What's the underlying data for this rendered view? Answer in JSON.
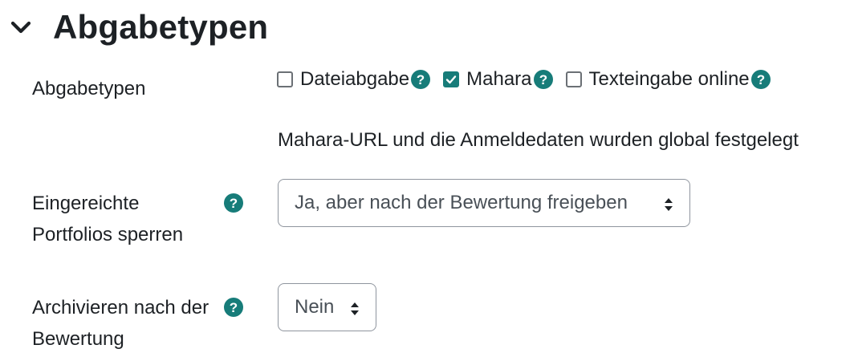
{
  "section": {
    "title": "Abgabetypen",
    "collapse_icon": "chevron-down-icon"
  },
  "submission_types": {
    "label": "Abgabetypen",
    "options": [
      {
        "label": "Dateiabgabe",
        "checked": false
      },
      {
        "label": "Mahara",
        "checked": true
      },
      {
        "label": "Texteingabe online",
        "checked": false
      }
    ],
    "info": "Mahara-URL und die Anmeldedaten wurden global festgelegt"
  },
  "lock_portfolios": {
    "label_line1": "Eingereichte",
    "label_line2": "Portfolios sperren",
    "selected": "Ja, aber nach der Bewertung freigeben"
  },
  "archive_after_grading": {
    "label_line1": "Archivieren nach der",
    "label_line2": "Bewertung",
    "selected": "Nein"
  },
  "colors": {
    "accent": "#177c79",
    "help_icon": "#0f6cbf",
    "text": "#1d2125"
  }
}
